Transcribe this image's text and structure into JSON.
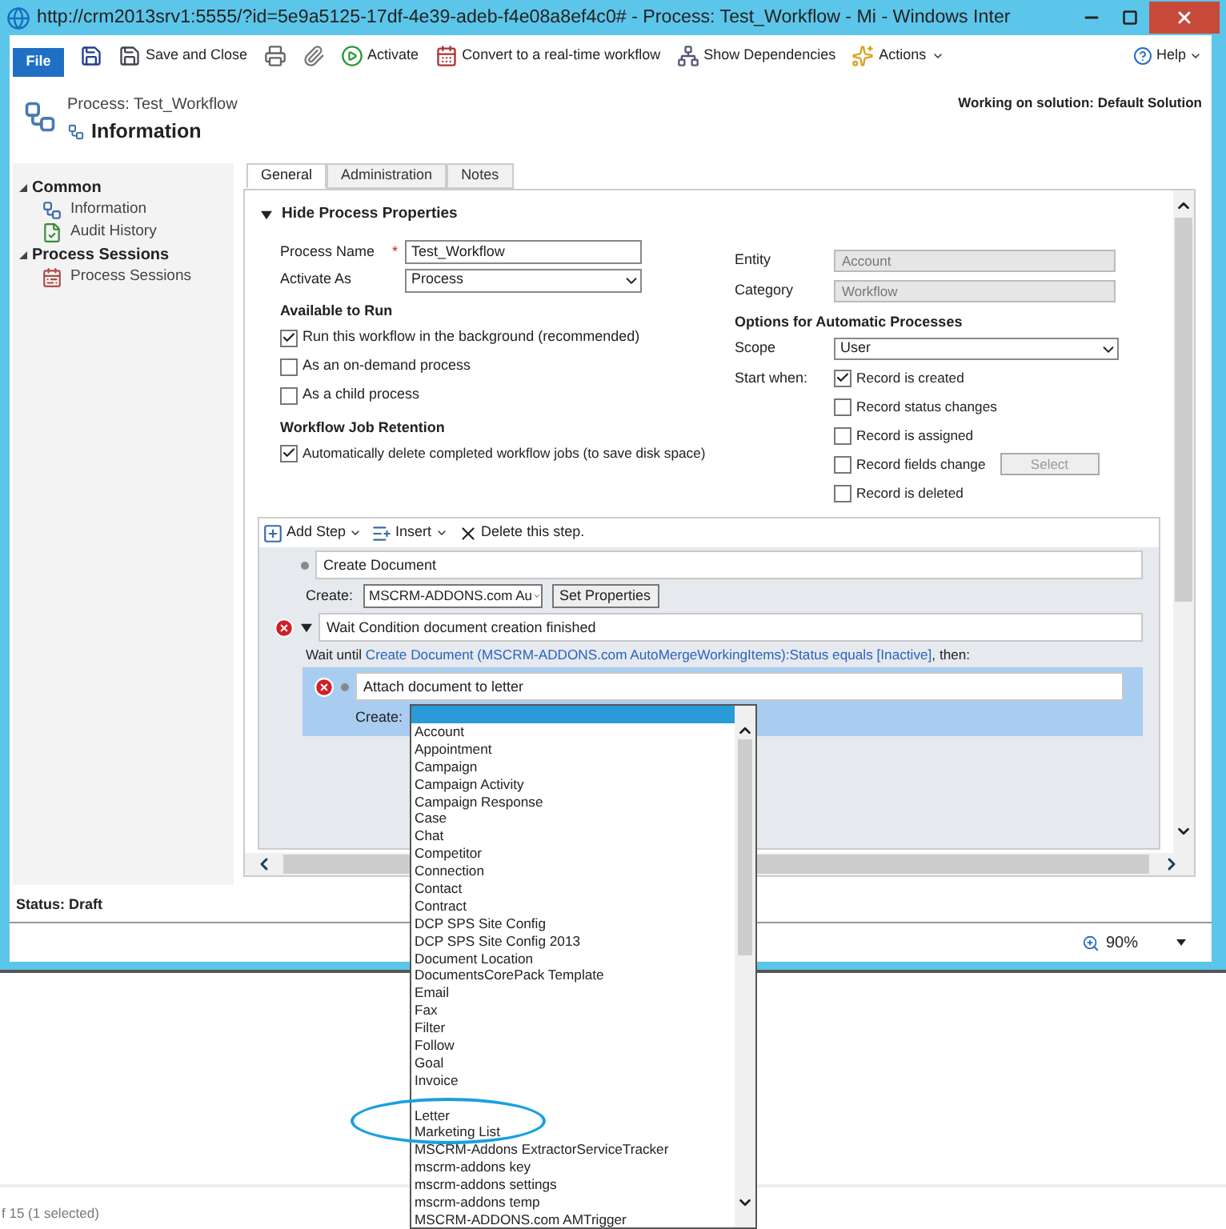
{
  "window": {
    "title": "http://crm2013srv1:5555/?id=5e9a5125-17df-4e39-adeb-f4e08a8ef4c0# - Process: Test_Workflow - Mi - Windows Inter"
  },
  "ribbon": {
    "file": "File",
    "buttons": [
      {
        "kind": "save"
      },
      {
        "kind": "save_close",
        "label": "Save and Close"
      },
      {
        "kind": "print"
      },
      {
        "kind": "attach"
      },
      {
        "kind": "activate",
        "label": "Activate"
      },
      {
        "kind": "convert",
        "label": "Convert to a real-time workflow"
      },
      {
        "kind": "dependencies",
        "label": "Show Dependencies"
      },
      {
        "kind": "actions",
        "label": "Actions",
        "menu": true
      }
    ],
    "help": "Help"
  },
  "header": {
    "breadcrumb": "Process: Test_Workflow",
    "title": "Information",
    "solution": "Working on solution: Default Solution"
  },
  "nav": {
    "sections": [
      {
        "label": "Common",
        "expanded": true,
        "items": [
          {
            "label": "Information",
            "kind": "process"
          },
          {
            "label": "Audit History",
            "kind": "audit"
          }
        ]
      },
      {
        "label": "Process Sessions",
        "expanded": true,
        "items": [
          {
            "label": "Process Sessions",
            "kind": "sessions"
          }
        ]
      }
    ]
  },
  "tabs": [
    {
      "label": "General",
      "selected": true
    },
    {
      "label": "Administration",
      "selected": false
    },
    {
      "label": "Notes",
      "selected": false
    }
  ],
  "form": {
    "section": {
      "label": "Hide Process Properties",
      "expanded": true
    },
    "process_name": {
      "label": "Process Name",
      "required_mark": "*",
      "value": "Test_Workflow"
    },
    "activate_as": {
      "label": "Activate As",
      "value": "Process"
    },
    "available_to_run": {
      "heading": "Available to Run",
      "options": [
        {
          "label": "Run this workflow in the background (recommended)",
          "checked": true
        },
        {
          "label": "As an on-demand process",
          "checked": false
        },
        {
          "label": "As a child process",
          "checked": false
        }
      ]
    },
    "retention": {
      "heading": "Workflow Job Retention",
      "options": [
        {
          "label": "Automatically delete completed workflow jobs (to save disk space)",
          "checked": true
        }
      ]
    },
    "entity": {
      "label": "Entity",
      "value": "Account",
      "disabled": true
    },
    "category": {
      "label": "Category",
      "value": "Workflow",
      "disabled": true
    },
    "automatic": {
      "heading": "Options for Automatic Processes",
      "scope": {
        "label": "Scope",
        "value": "User"
      },
      "start_when": {
        "label": "Start when:",
        "options": [
          {
            "label": "Record is created",
            "checked": true
          },
          {
            "label": "Record status changes",
            "checked": false
          },
          {
            "label": "Record is assigned",
            "checked": false
          },
          {
            "label": "Record fields change",
            "checked": false,
            "button": "Select"
          },
          {
            "label": "Record is deleted",
            "checked": false
          }
        ]
      }
    }
  },
  "steps": {
    "toolbar": [
      {
        "kind": "add",
        "label": "Add Step",
        "menu": true
      },
      {
        "kind": "insert",
        "label": "Insert",
        "menu": true
      },
      {
        "kind": "delete",
        "label": "Delete this step."
      }
    ],
    "items": [
      {
        "kind": "action",
        "error": false,
        "title": "Create Document",
        "create_label": "Create:",
        "create_value": "MSCRM-ADDONS.com Au",
        "button": "Set Properties"
      },
      {
        "kind": "wait",
        "error": true,
        "expanded": true,
        "title": "Wait Condition document creation finished",
        "prefix": "Wait until",
        "link": "Create Document (MSCRM-ADDONS.com AutoMergeWorkingItems):Status equals [Inactive]",
        "suffix": ", then:",
        "children": [
          {
            "kind": "action",
            "error": true,
            "selected": true,
            "title": "Attach document to letter",
            "create_label": "Create:"
          }
        ]
      }
    ]
  },
  "status": "Status: Draft",
  "browser_status": {
    "zoom": "90%"
  },
  "dropdown": {
    "items": [
      {
        "label": "Account"
      },
      {
        "label": "Appointment"
      },
      {
        "label": "Campaign"
      },
      {
        "label": "Campaign Activity"
      },
      {
        "label": "Campaign Response"
      },
      {
        "label": "Case"
      },
      {
        "label": "Chat"
      },
      {
        "label": "Competitor"
      },
      {
        "label": "Connection"
      },
      {
        "label": "Contact"
      },
      {
        "label": "Contract"
      },
      {
        "label": "DCP SPS Site Config"
      },
      {
        "label": "DCP SPS Site Config 2013"
      },
      {
        "label": "Document Location"
      },
      {
        "label": "DocumentsCorePack Template"
      },
      {
        "label": "Email"
      },
      {
        "label": "Fax"
      },
      {
        "label": "Filter"
      },
      {
        "label": "Follow"
      },
      {
        "label": "Goal"
      },
      {
        "label": "Invoice"
      },
      {
        "kind": "covered"
      },
      {
        "label": "Letter"
      },
      {
        "label": "Marketing List"
      },
      {
        "label": "MSCRM-Addons ExtractorServiceTracker"
      },
      {
        "label": "mscrm-addons key"
      },
      {
        "label": "mscrm-addons settings"
      },
      {
        "label": "mscrm-addons temp"
      },
      {
        "label": "MSCRM-ADDONS.com AMTrigger"
      }
    ]
  },
  "background": {
    "text": "f 15 (1 selected)"
  }
}
